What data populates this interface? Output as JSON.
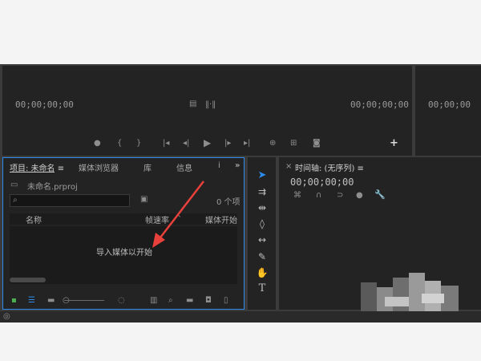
{
  "source_monitor": {
    "left_timecode": "00;00;00;00",
    "right_timecode": "00;00;00;00"
  },
  "program_monitor": {
    "timecode": "00;00;00"
  },
  "project_panel": {
    "tabs": [
      {
        "label": "项目: 未命名",
        "active": true
      },
      {
        "label": "媒体浏览器",
        "active": false
      },
      {
        "label": "库",
        "active": false
      },
      {
        "label": "信息",
        "active": false
      },
      {
        "label": "i",
        "active": false
      }
    ],
    "menu_glyph": "≡",
    "overflow_glyph": "»",
    "project_file": "未命名.prproj",
    "item_count": "0 个项",
    "columns": {
      "name": "名称",
      "frame_rate": "帧速率",
      "media_start": "媒体开始"
    },
    "empty_hint": "导入媒体以开始"
  },
  "timeline_panel": {
    "close_glyph": "×",
    "title": "时间轴: (无序列)",
    "menu_glyph": "≡",
    "timecode": "00;00;00;00"
  },
  "colors": {
    "accent_blue": "#2d8ceb",
    "arrow_red": "#e8403a",
    "panel_bg": "#232323",
    "frame_bg": "#3b3b3b"
  }
}
